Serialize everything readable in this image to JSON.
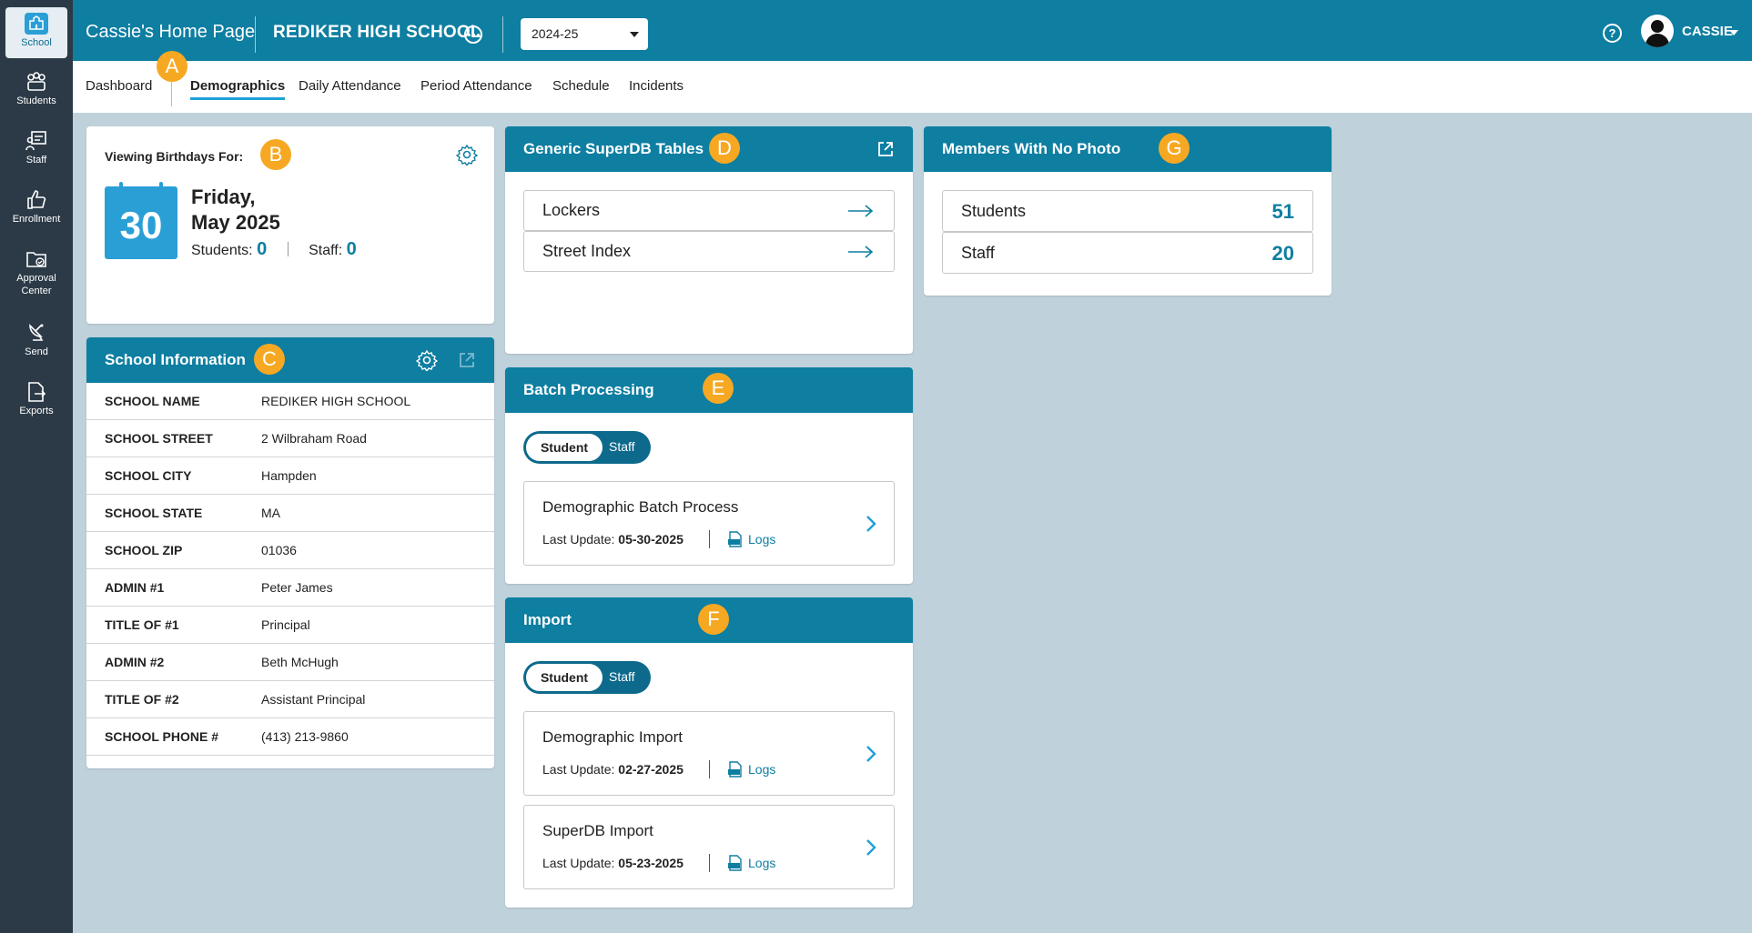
{
  "sidebar": {
    "items": [
      {
        "label": "School",
        "icon": "school-icon"
      },
      {
        "label": "Students",
        "icon": "students-icon"
      },
      {
        "label": "Staff",
        "icon": "staff-icon"
      },
      {
        "label": "Enrollment",
        "icon": "thumbs-up-icon"
      },
      {
        "label": "Approval",
        "label2": "Center",
        "icon": "folder-check-icon"
      },
      {
        "label": "Send",
        "icon": "satellite-icon"
      },
      {
        "label": "Exports",
        "icon": "export-file-icon"
      }
    ]
  },
  "header": {
    "home_title": "Cassie's Home Page",
    "school_name": "REDIKER HIGH SCHOOL",
    "year": "2024-25",
    "help": "?",
    "user": "CASSIE"
  },
  "tabs": [
    "Dashboard",
    "Demographics",
    "Daily Attendance",
    "Period Attendance",
    "Schedule",
    "Incidents"
  ],
  "active_tab": "Demographics",
  "badges": {
    "a": "A",
    "b": "B",
    "c": "C",
    "d": "D",
    "e": "E",
    "f": "F",
    "g": "G"
  },
  "birthdays": {
    "title": "Viewing Birthdays For:",
    "day": "30",
    "weekday": "Friday,",
    "month_year": "May 2025",
    "students_label": "Students:",
    "students_count": "0",
    "staff_label": "Staff:",
    "staff_count": "0"
  },
  "school_info": {
    "title": "School Information",
    "rows": [
      {
        "k": "SCHOOL NAME",
        "v": "REDIKER HIGH SCHOOL"
      },
      {
        "k": "SCHOOL STREET",
        "v": "2 Wilbraham Road"
      },
      {
        "k": "SCHOOL CITY",
        "v": "Hampden"
      },
      {
        "k": "SCHOOL STATE",
        "v": "MA"
      },
      {
        "k": "SCHOOL ZIP",
        "v": "01036"
      },
      {
        "k": "ADMIN #1",
        "v": "Peter James"
      },
      {
        "k": "TITLE OF #1",
        "v": "Principal"
      },
      {
        "k": "ADMIN #2",
        "v": "Beth McHugh"
      },
      {
        "k": "TITLE OF #2",
        "v": "Assistant Principal"
      },
      {
        "k": "SCHOOL PHONE #",
        "v": "(413) 213-9860"
      }
    ]
  },
  "superdb": {
    "title": "Generic SuperDB Tables",
    "links": [
      "Lockers",
      "Street Index"
    ]
  },
  "batch": {
    "title": "Batch Processing",
    "toggle_on": "Student",
    "toggle_off": "Staff",
    "items": [
      {
        "title": "Demographic Batch Process",
        "update_label": "Last Update:",
        "date": "05-30-2025",
        "logs": "Logs"
      }
    ]
  },
  "import": {
    "title": "Import",
    "toggle_on": "Student",
    "toggle_off": "Staff",
    "items": [
      {
        "title": "Demographic Import",
        "update_label": "Last Update:",
        "date": "02-27-2025",
        "logs": "Logs"
      },
      {
        "title": "SuperDB Import",
        "update_label": "Last Update:",
        "date": "05-23-2025",
        "logs": "Logs"
      }
    ]
  },
  "members": {
    "title": "Members With No Photo",
    "rows": [
      {
        "label": "Students",
        "count": "51"
      },
      {
        "label": "Staff",
        "count": "20"
      }
    ]
  },
  "colors": {
    "brand": "#0e7ea1",
    "accent": "#1ea0d8",
    "badge": "#f7a823",
    "sidebar": "#2c3a47",
    "background": "#bfd2dc"
  }
}
